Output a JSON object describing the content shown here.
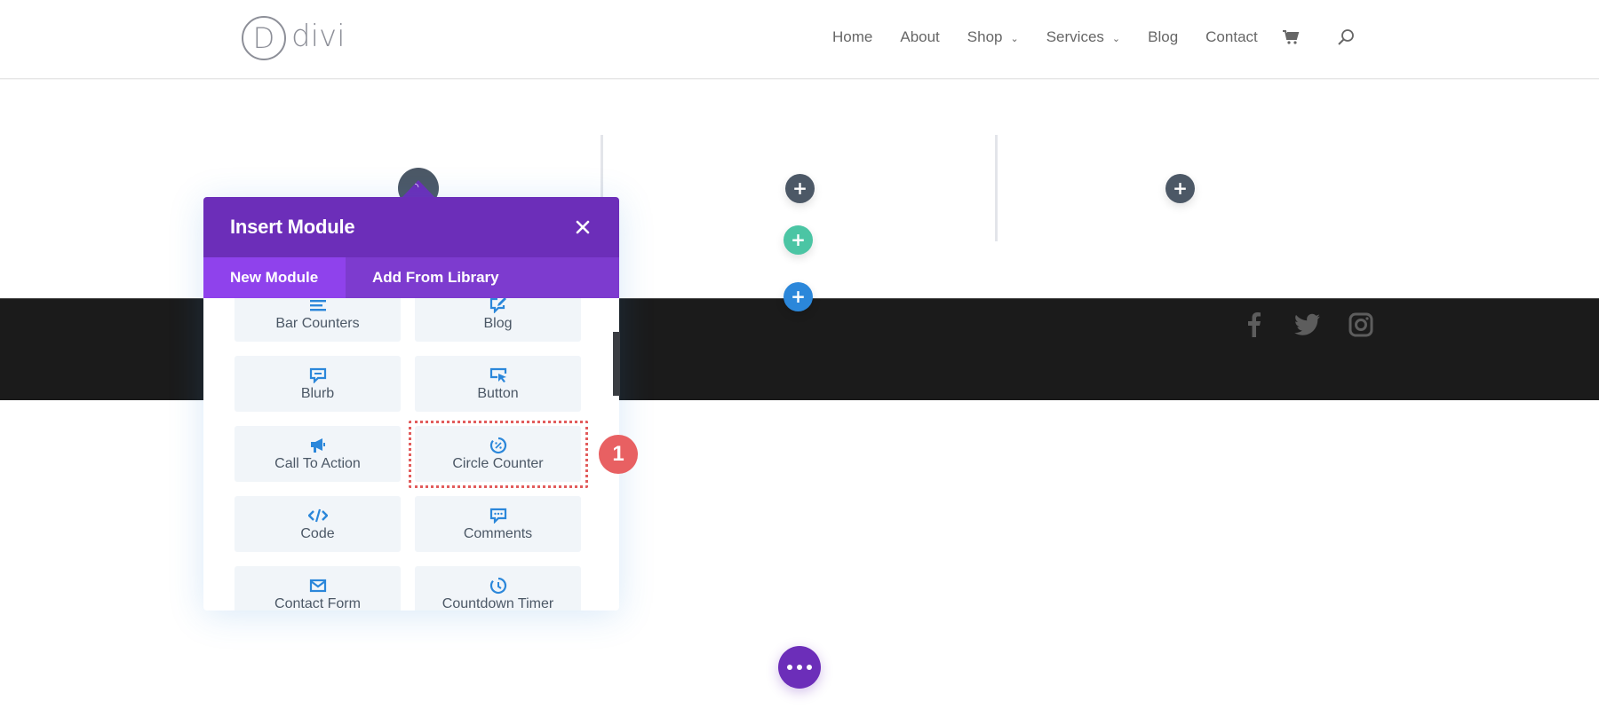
{
  "header": {
    "logo_letter": "D",
    "logo_text": "divi",
    "nav": [
      {
        "label": "Home",
        "has_dropdown": false
      },
      {
        "label": "About",
        "has_dropdown": false
      },
      {
        "label": "Shop",
        "has_dropdown": true
      },
      {
        "label": "Services",
        "has_dropdown": true
      },
      {
        "label": "Blog",
        "has_dropdown": false
      },
      {
        "label": "Contact",
        "has_dropdown": false
      }
    ],
    "icons": [
      "cart-icon",
      "search-icon"
    ]
  },
  "builder": {
    "add_buttons": [
      "+",
      "+",
      "+",
      "+"
    ],
    "colors": {
      "dark": "#4c5866",
      "teal": "#4bc5a4",
      "blue": "#2b87da",
      "purple": "#6c2eb9"
    }
  },
  "footer": {
    "social_icons": [
      "facebook-icon",
      "twitter-icon",
      "instagram-icon"
    ]
  },
  "modal": {
    "title": "Insert Module",
    "close_icon": "×",
    "tabs": [
      {
        "label": "New Module",
        "active": true
      },
      {
        "label": "Add From Library",
        "active": false
      }
    ],
    "modules": [
      {
        "label": "Bar Counters",
        "icon": "bar-counters-icon"
      },
      {
        "label": "Blog",
        "icon": "blog-icon"
      },
      {
        "label": "Blurb",
        "icon": "blurb-icon"
      },
      {
        "label": "Button",
        "icon": "button-icon"
      },
      {
        "label": "Call To Action",
        "icon": "call-to-action-icon"
      },
      {
        "label": "Circle Counter",
        "icon": "circle-counter-icon"
      },
      {
        "label": "Code",
        "icon": "code-icon"
      },
      {
        "label": "Comments",
        "icon": "comments-icon"
      },
      {
        "label": "Contact Form",
        "icon": "contact-form-icon"
      },
      {
        "label": "Countdown Timer",
        "icon": "countdown-timer-icon"
      }
    ],
    "highlighted_module": "Circle Counter"
  },
  "step_badge": "1",
  "accent_colors": {
    "highlight": "#e25c5c",
    "badge": "#e86062"
  }
}
